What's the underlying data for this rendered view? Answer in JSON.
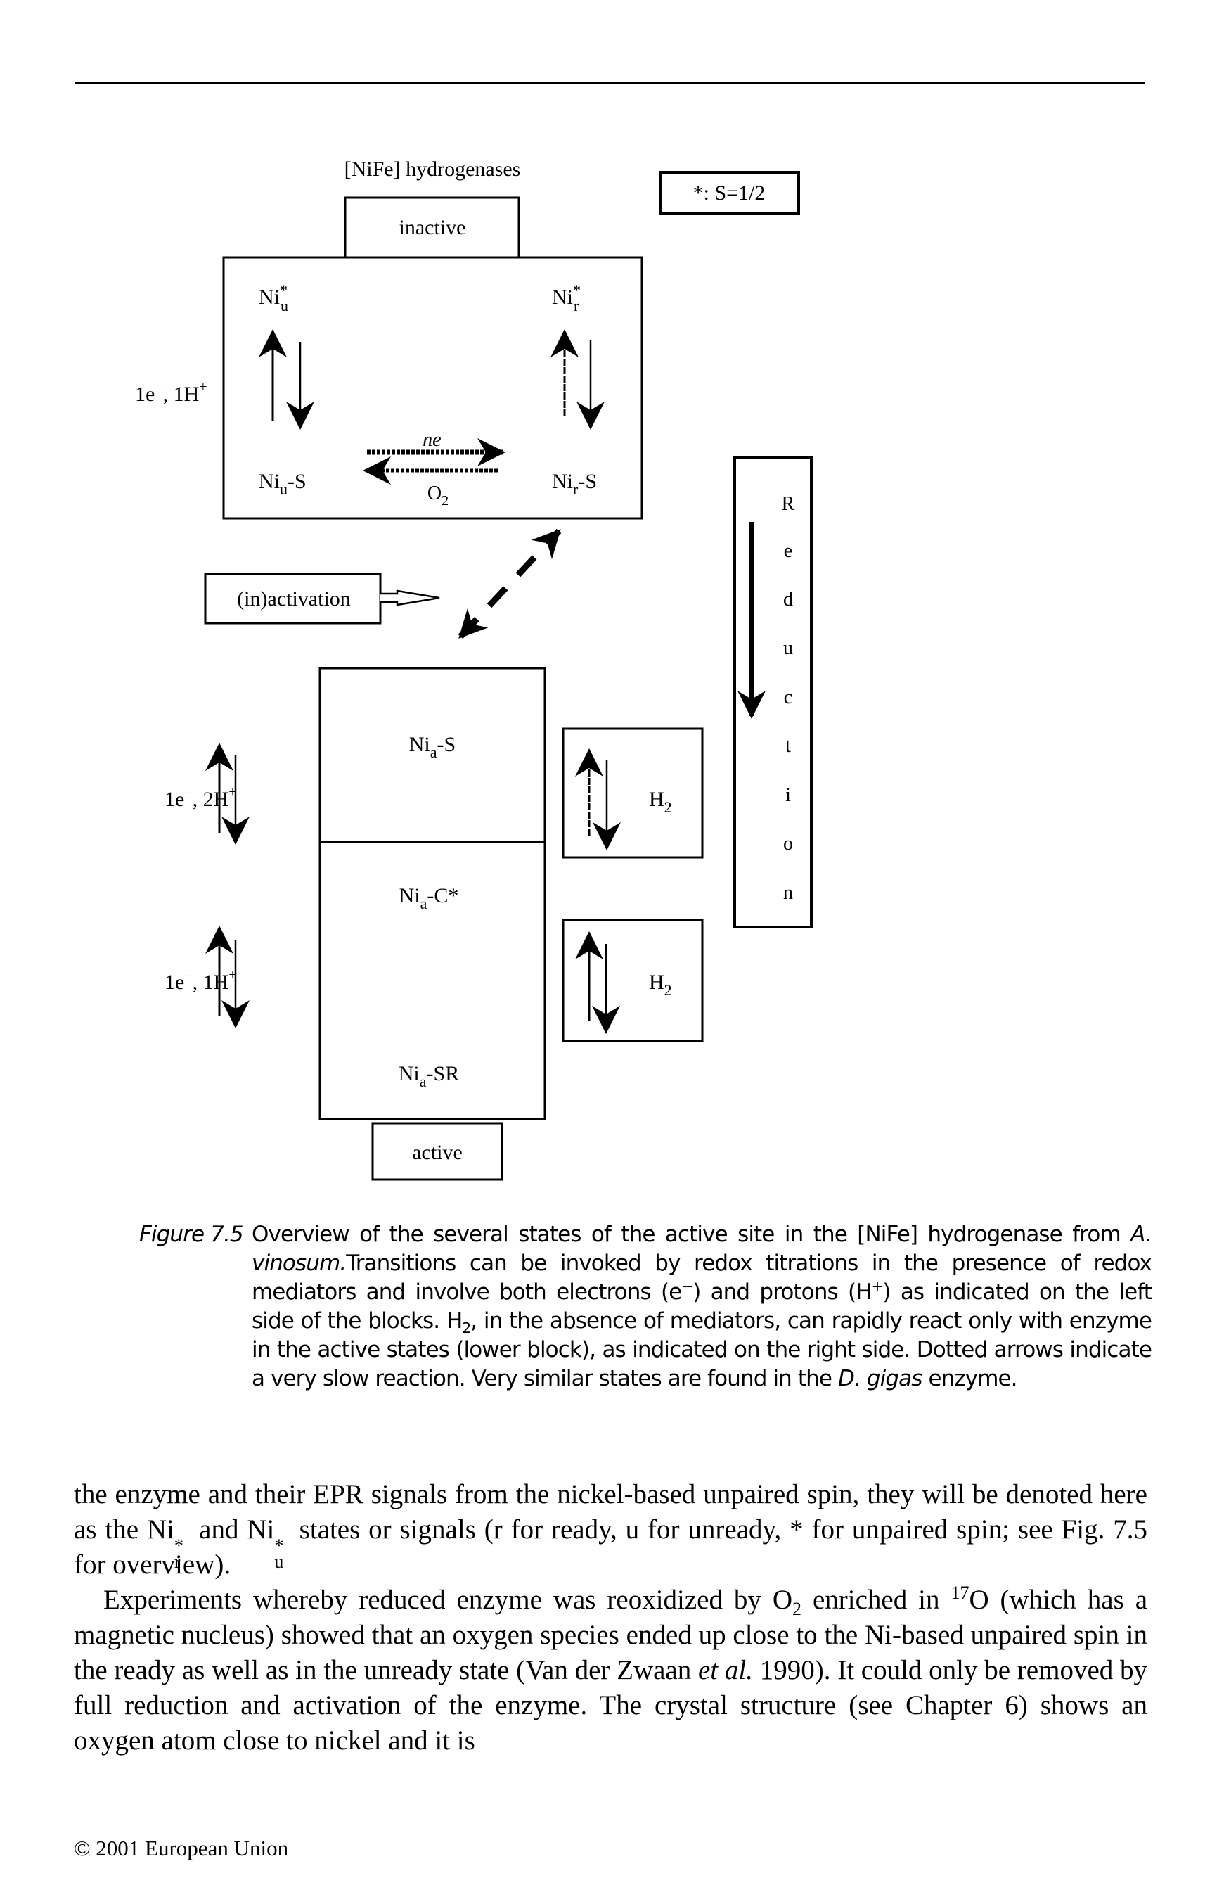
{
  "diagram": {
    "title": "[NiFe] hydrogenases",
    "legend": "*: S=1/2",
    "inactive_label": "inactive",
    "active_label": "active",
    "inactivation_label": "(in)activation",
    "top_block": {
      "left_side_label": {
        "base": "1e",
        "sup1": "−",
        "mid": ", 1H",
        "sup2": "+"
      },
      "states": {
        "top_left": {
          "base": "Ni",
          "sub": "u",
          "sup": "*"
        },
        "top_right": {
          "base": "Ni",
          "sub": "r",
          "sup": "*"
        },
        "bottom_left": {
          "base": "Ni",
          "sub": "u",
          "suffix": "-S"
        },
        "bottom_right": {
          "base": "Ni",
          "sub": "r",
          "suffix": "-S"
        }
      },
      "forward_arrow_label": {
        "base": "ne",
        "sup": "−"
      },
      "reverse_arrow_label": {
        "base": "O",
        "sub": "2"
      }
    },
    "lower_block": {
      "upper_left_label": {
        "base": "1e",
        "sup1": "−",
        "mid": ", 2H",
        "sup2": "+"
      },
      "lower_left_label": {
        "base": "1e",
        "sup1": "−",
        "mid": ", 1H",
        "sup2": "+"
      },
      "states": {
        "top": {
          "base": "Ni",
          "sub": "a",
          "suffix": "-S"
        },
        "middle": {
          "base": "Ni",
          "sub": "a",
          "suffix": "-C*"
        },
        "bottom": {
          "base": "Ni",
          "sub": "a",
          "suffix": "-SR"
        }
      },
      "h2_boxes": [
        {
          "base": "H",
          "sub": "2"
        },
        {
          "base": "H",
          "sub": "2"
        }
      ]
    },
    "reduction_letters": [
      "R",
      "e",
      "d",
      "u",
      "c",
      "t",
      "i",
      "o",
      "n"
    ]
  },
  "caption": {
    "label": "Figure 7.5",
    "text_1": "Overview of the several states of the active site in the [NiFe] hydrogenase from ",
    "organism_1": "A. vinosum.",
    "text_2": "Transitions can be invoked by redox titrations in the presence of redox mediators and involve both electrons (e",
    "electron_sup": "−",
    "text_3": ") and protons (H",
    "proton_sup": "+",
    "text_4": ") as indicated on the left side of the blocks. H",
    "h2_sub": "2",
    "text_5": ", in the absence of mediators, can rapidly react only with enzyme in the active states (lower block), as indicated on the right side. Dotted arrows indicate a very slow reaction. Very similar states are found in the ",
    "organism_2": "D. gigas",
    "text_6": " enzyme."
  },
  "body": {
    "para1": {
      "t1": "the enzyme and their EPR signals from the nickel-based unpaired spin, they will be denoted here as the Ni",
      "s1_sup": "*",
      "s1_sub": "r",
      "t2": " and Ni",
      "s2_sup": "*",
      "s2_sub": "u",
      "t3": " states or signals (r for ready, u for unready, * for unpaired spin; see Fig. 7.5 for overview)."
    },
    "para2": {
      "t1": "Experiments whereby reduced enzyme was reoxidized by O",
      "o2_sub": "2",
      "t2": " enriched in ",
      "iso_sup": "17",
      "t3": "O (which has a magnetic nucleus) showed that an oxygen species ended up close to the Ni-based unpaired spin in the ready as well as in the unready state (Van der Zwaan ",
      "etal": "et al.",
      "t4": " 1990). It could only be removed by full reduction and activation of the enzyme. The crystal structure (see Chapter 6) shows an oxygen atom close to nickel and it is"
    }
  },
  "footer": {
    "copyright": "© 2001 European Union"
  }
}
